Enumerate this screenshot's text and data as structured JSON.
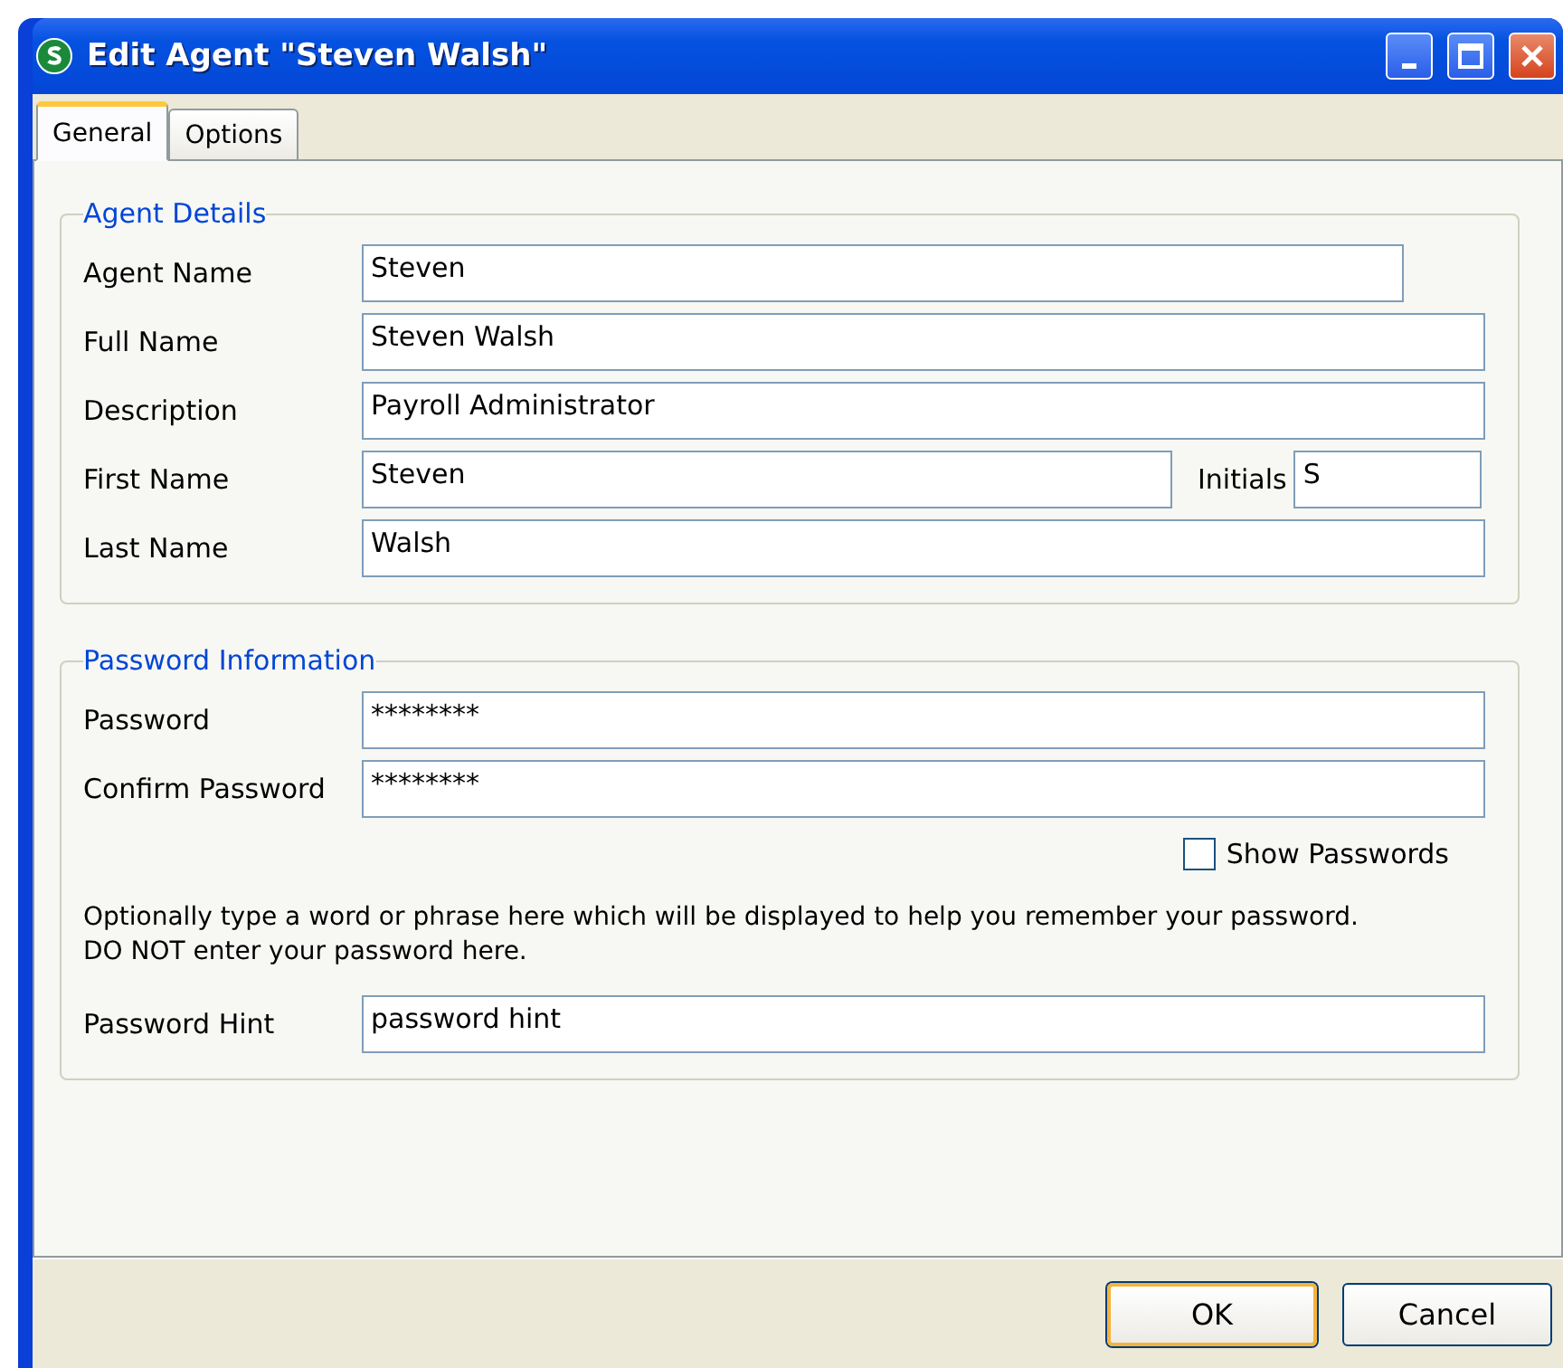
{
  "window": {
    "title": "Edit Agent \"Steven Walsh\""
  },
  "tabs": [
    {
      "label": "General",
      "selected": true
    },
    {
      "label": "Options",
      "selected": false
    }
  ],
  "agent_details": {
    "title": "Agent Details",
    "fields": [
      {
        "kind": "short",
        "label": "Agent Name",
        "value": "Steven"
      },
      {
        "kind": "full",
        "label": "Full Name",
        "value": "Steven Walsh"
      },
      {
        "kind": "full",
        "label": "Description",
        "value": "Payroll Administrator"
      },
      {
        "kind": "split",
        "label": "First Name",
        "value": "Steven",
        "extra_label": "Initials",
        "extra_value": "S"
      },
      {
        "kind": "full",
        "label": "Last Name",
        "value": "Walsh"
      }
    ]
  },
  "password_information": {
    "title": "Password Information",
    "fields": [
      {
        "kind": "full",
        "label": "Password",
        "value": "********"
      },
      {
        "kind": "full",
        "label": "Confirm Password",
        "value": "********"
      }
    ],
    "show_passwords": {
      "label": "Show Passwords",
      "checked": false
    },
    "hint_text": "Optionally type a word or phrase here which will be displayed to help you remember your password.\nDO NOT enter your password here.",
    "hint_field": {
      "label": "Password Hint",
      "value": "password hint"
    }
  },
  "buttons": [
    {
      "label": "OK",
      "default": true
    },
    {
      "label": "Cancel",
      "default": false
    }
  ]
}
